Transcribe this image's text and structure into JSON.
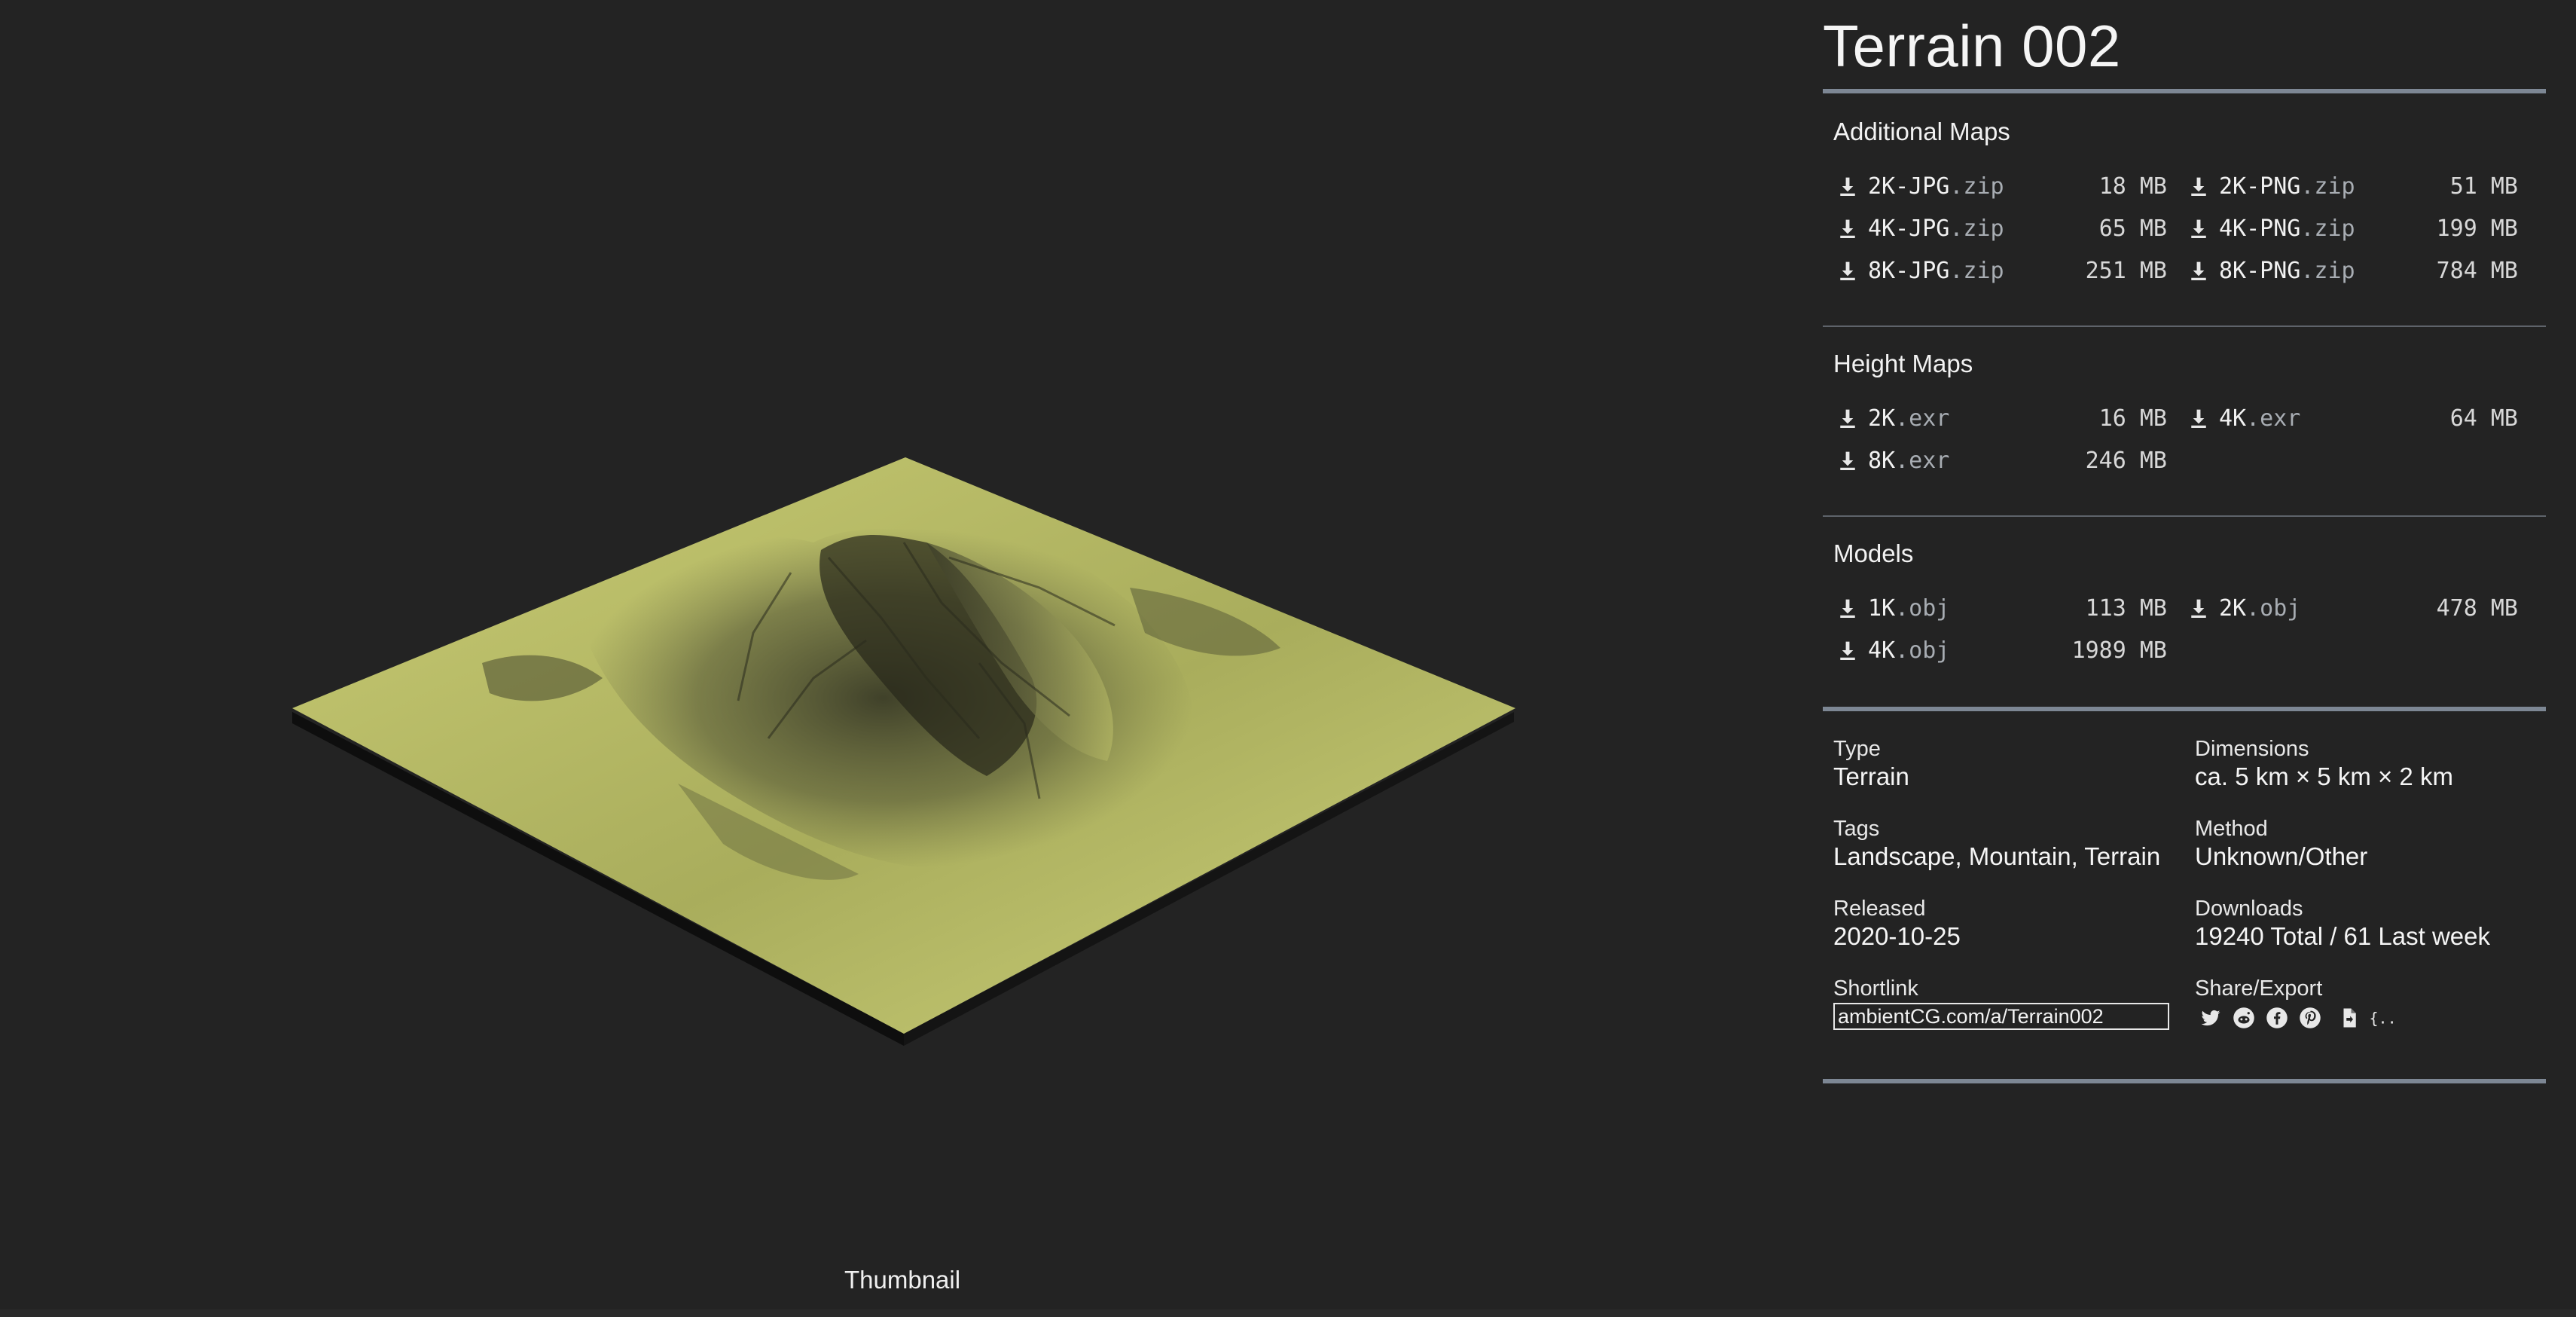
{
  "viewer": {
    "caption": "Thumbnail",
    "terrain_color": "#c9cc74"
  },
  "asset": {
    "title": "Terrain 002"
  },
  "sections": [
    {
      "title": "Additional Maps",
      "items": [
        {
          "name": "2K-JPG",
          "ext": ".zip",
          "size": "18 MB"
        },
        {
          "name": "2K-PNG",
          "ext": ".zip",
          "size": "51 MB"
        },
        {
          "name": "4K-JPG",
          "ext": ".zip",
          "size": "65 MB"
        },
        {
          "name": "4K-PNG",
          "ext": ".zip",
          "size": "199 MB"
        },
        {
          "name": "8K-JPG",
          "ext": ".zip",
          "size": "251 MB"
        },
        {
          "name": "8K-PNG",
          "ext": ".zip",
          "size": "784 MB"
        }
      ]
    },
    {
      "title": "Height Maps",
      "items": [
        {
          "name": "2K",
          "ext": ".exr",
          "size": "16 MB"
        },
        {
          "name": "4K",
          "ext": ".exr",
          "size": "64 MB"
        },
        {
          "name": "8K",
          "ext": ".exr",
          "size": "246 MB"
        }
      ]
    },
    {
      "title": "Models",
      "items": [
        {
          "name": "1K",
          "ext": ".obj",
          "size": "113 MB"
        },
        {
          "name": "2K",
          "ext": ".obj",
          "size": "478 MB"
        },
        {
          "name": "4K",
          "ext": ".obj",
          "size": "1989 MB"
        }
      ]
    }
  ],
  "meta": {
    "type_label": "Type",
    "type_value": "Terrain",
    "dimensions_label": "Dimensions",
    "dimensions_value": "ca. 5 km × 5 km × 2 km",
    "tags_label": "Tags",
    "tags_value": "Landscape, Mountain, Terrain",
    "method_label": "Method",
    "method_value": "Unknown/Other",
    "released_label": "Released",
    "released_value": "2020-10-25",
    "downloads_label": "Downloads",
    "downloads_value": "19240 Total / 61 Last week",
    "shortlink_label": "Shortlink",
    "shortlink_value": "ambientCG.com/a/Terrain002",
    "share_label": "Share/Export"
  },
  "share_icons": [
    "twitter-icon",
    "reddit-icon",
    "facebook-icon",
    "pinterest-icon",
    "file-export-icon",
    "json-icon"
  ],
  "colors": {
    "background": "#232323",
    "rule_thick": "#7d8794",
    "rule_thin": "#5e636a"
  }
}
